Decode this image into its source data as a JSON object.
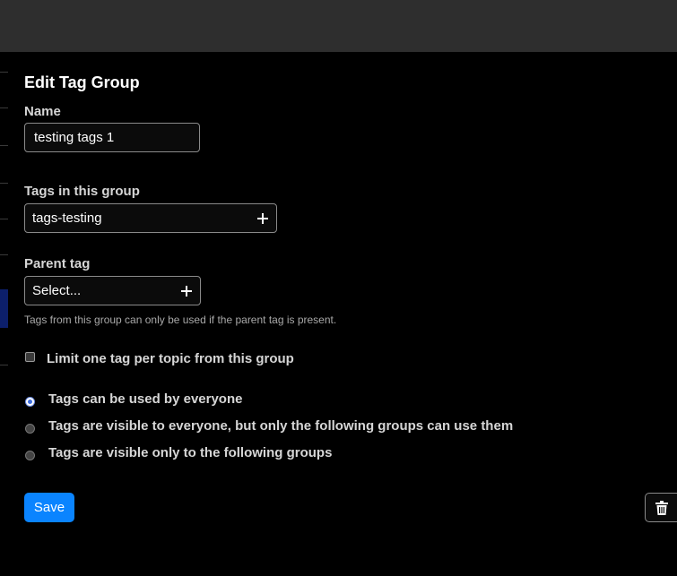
{
  "form": {
    "title": "Edit Tag Group",
    "name_label": "Name",
    "name_value": "testing tags 1",
    "tags_label": "Tags in this group",
    "tags_value": "tags-testing",
    "parent_label": "Parent tag",
    "parent_placeholder": "Select...",
    "parent_help": "Tags from this group can only be used if the parent tag is present.",
    "one_per_topic_label": "Limit one tag per topic from this group",
    "one_per_topic_checked": false,
    "visibility_options": [
      {
        "label": "Tags can be used by everyone",
        "selected": true
      },
      {
        "label": "Tags are visible to everyone, but only the following groups can use them",
        "selected": false
      },
      {
        "label": "Tags are visible only to the following groups",
        "selected": false
      }
    ],
    "save_label": "Save"
  },
  "icons": {
    "add": "plus-icon",
    "delete": "trash-icon"
  },
  "colors": {
    "background": "#000000",
    "header": "#2e2e2e",
    "primary_button": "#0a84ff"
  }
}
